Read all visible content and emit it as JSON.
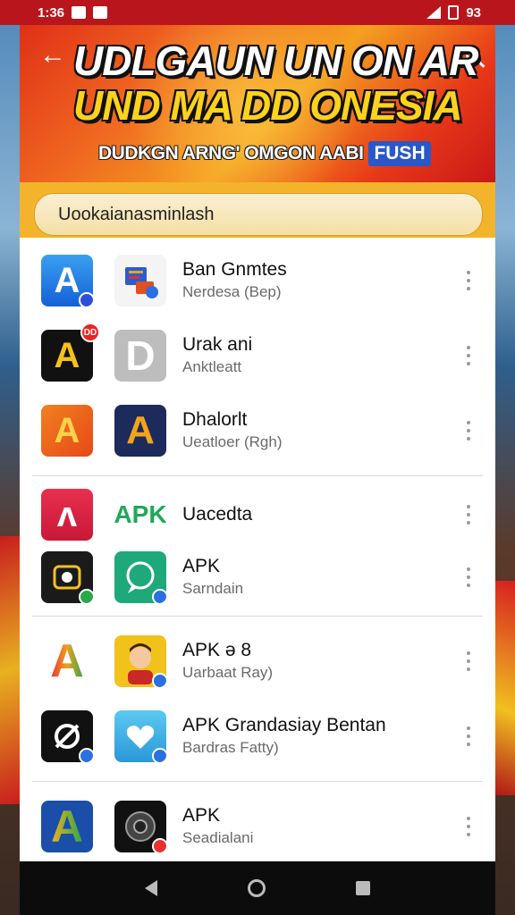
{
  "status_bar": {
    "time": "1:36",
    "right_text": "93"
  },
  "header": {
    "title_line1": "UDLGAUN UN ON AR",
    "title_line2": "UND  MA DD ONESIA",
    "subtitle": "DUDKGN ARNG' OMGON AABI",
    "badge": "FUSH",
    "back_icon": "arrow-left-icon",
    "search_icon": "search-icon"
  },
  "search": {
    "value": "Uookaianasminlash"
  },
  "rows": [
    {
      "title": "Ban Gnmtes",
      "sub": "Nerdesa (Bep)"
    },
    {
      "title": "Urak ani",
      "sub": "Anktleatt"
    },
    {
      "title": "Dhalorlt",
      "sub": "Ueatloer (Rgh)"
    },
    {
      "title": "Uacedta",
      "sub": ""
    },
    {
      "title": "APK",
      "sub": "Sarndain"
    },
    {
      "title": "APK ə 8",
      "sub": "Uarbaat Ray)"
    },
    {
      "title": "APK Grandasiay Bentan",
      "sub": "Bardras Fatty)"
    },
    {
      "title": "APK",
      "sub": "Seadialani"
    }
  ],
  "icons": {
    "r1a_glyph": "A",
    "r2a_glyph": "A",
    "r2b_glyph": "D",
    "r3a_glyph": "A",
    "r3b_glyph": "A",
    "r4a_glyph": "ʌ",
    "r4b_glyph": "APK",
    "r6a_glyph": "A",
    "r8a_glyph": "A",
    "r2a_badge": "DD"
  },
  "colors": {
    "status_bar": "#b8161c",
    "banner_yellow": "#ffd21c",
    "search_strip": "#f3b42c",
    "apk_green": "#1fa85a"
  }
}
